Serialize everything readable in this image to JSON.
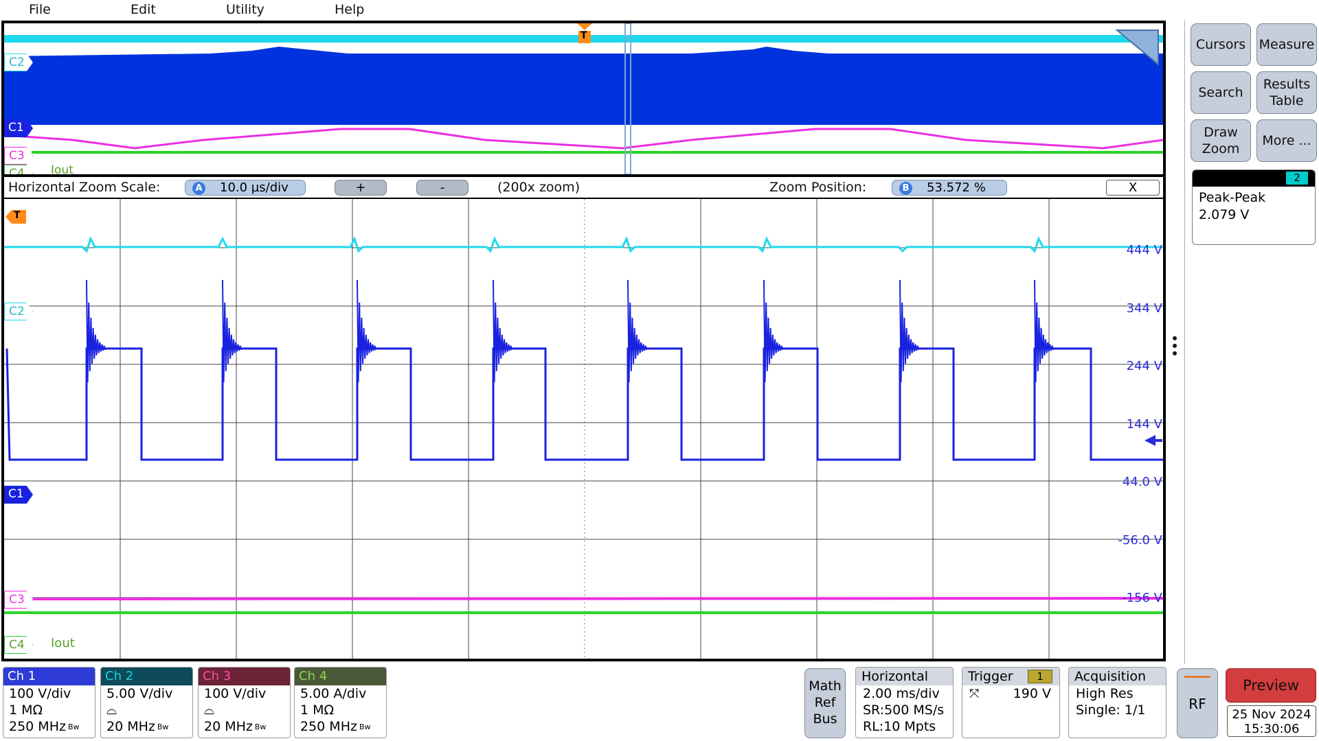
{
  "menu": {
    "file": "File",
    "edit": "Edit",
    "utility": "Utility",
    "help": "Help"
  },
  "overview": {
    "markers": {
      "c2": "C2",
      "c1": "C1",
      "c3": "C3",
      "c4": "C4",
      "c4_name": "Iout"
    },
    "trigger_label": "T"
  },
  "zoom_bar": {
    "scale_label": "Horizontal Zoom Scale:",
    "scale_badge": "A",
    "scale_value": "10.0 µs/div",
    "plus": "+",
    "minus": "-",
    "zoom_factor": "(200x zoom)",
    "position_label": "Zoom Position:",
    "position_badge": "B",
    "position_value": "53.572 %",
    "close": "X"
  },
  "zoom_view": {
    "trigger_label": "T",
    "markers": {
      "c2": "C2",
      "c1": "C1",
      "c3": "C3",
      "c4": "C4",
      "c4_name": "Iout"
    },
    "axis_labels": [
      "444 V",
      "344 V",
      "244 V",
      "144 V",
      "44.0 V",
      "-56.0 V",
      "-156 V"
    ]
  },
  "side_panel": {
    "cursors": "Cursors",
    "measure": "Measure",
    "search": "Search",
    "results_table": "Results\nTable",
    "draw_zoom": "Draw\nZoom",
    "more": "More ...",
    "measurement": {
      "badge": "2",
      "name": "Peak-Peak",
      "value": "2.079 V"
    }
  },
  "channels": [
    {
      "name": "Ch 1",
      "scale": "100 V/div",
      "line2": "1 MΩ",
      "bw": "250 MHz",
      "header_color": "#2f3bd6",
      "text_color": "#ffffff"
    },
    {
      "name": "Ch 2",
      "scale": "5.00 V/div",
      "line2": "",
      "bw": "20 MHz",
      "header_color": "#0d4a5a",
      "text_color": "#1fd2e0"
    },
    {
      "name": "Ch 3",
      "scale": "100 V/div",
      "line2": "",
      "bw": "20 MHz",
      "header_color": "#6b2335",
      "text_color": "#ff4fa0"
    },
    {
      "name": "Ch 4",
      "scale": "5.00 A/div",
      "line2": "1 MΩ",
      "bw": "250 MHz",
      "header_color": "#4b5838",
      "text_color": "#8ad94a"
    }
  ],
  "bw_mark": "Bw",
  "math_ref_bus": "Math\nRef\nBus",
  "horizontal": {
    "title": "Horizontal",
    "scale": "2.00 ms/div",
    "sr": "SR:500 MS/s",
    "rl": "RL:10 Mpts"
  },
  "trigger": {
    "title": "Trigger",
    "source": "1",
    "level": "190 V"
  },
  "acquisition": {
    "title": "Acquisition",
    "mode": "High Res",
    "single": "Single: 1/1"
  },
  "rf": "RF",
  "preview": "Preview",
  "date": "25 Nov 2024",
  "time": "15:30:06",
  "colors": {
    "ch1": "#1a22e0",
    "ch2": "#1fd8ec",
    "ch3": "#ec2ee0",
    "ch4": "#28d428",
    "overview_fill": "#0033dd"
  }
}
